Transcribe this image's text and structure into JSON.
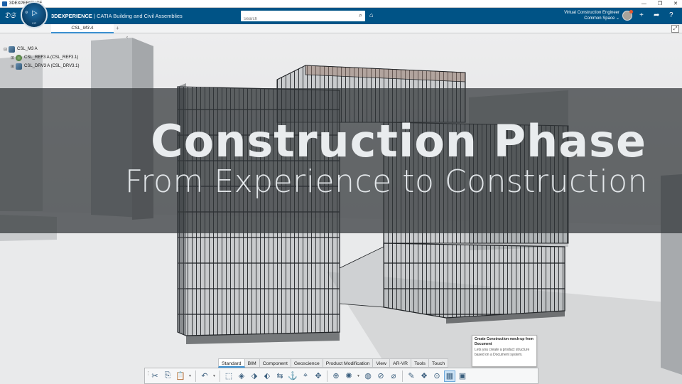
{
  "os_window": {
    "title": "3DEXPERIENCE",
    "minimize": "—",
    "restore": "❐",
    "close": "✕"
  },
  "header": {
    "brand_logo": "ds-logo-icon",
    "compass": {
      "quick_start": "⚙",
      "play": "▷",
      "version": "V.R"
    },
    "product": "3DEXPERIENCE",
    "separator": " | ",
    "app_name": "CATIA Building and Civil Assemblies",
    "search": {
      "placeholder": "Search",
      "value": ""
    },
    "user": {
      "name": "Virtual Construction Engineer",
      "space": "Common Space"
    },
    "icons": {
      "add": "+",
      "share": "➦",
      "help": "?"
    }
  },
  "tabs": [
    {
      "label": "CSL_M3 A",
      "active": true
    }
  ],
  "tab_add": "+",
  "tree": {
    "root": {
      "expander": "⊟",
      "label": "CSL_M3 A"
    },
    "children": [
      {
        "expander": "⊞",
        "label": "CSL_REF3 A (CSL_REF3.1)"
      },
      {
        "expander": "⊞",
        "label": "CSL_DRV3 A (CSL_DRV3.1)"
      }
    ]
  },
  "banner": {
    "title": "Construction Phase",
    "subtitle": "From Experience to Construction"
  },
  "tooltip": {
    "title": "Create Construction mock-up from Document",
    "description": "Lets you create a product structure based on a Document system."
  },
  "action_bar": {
    "sections": [
      {
        "label": "Standard",
        "active": true
      },
      {
        "label": "BIM",
        "active": false
      },
      {
        "label": "Component",
        "active": false
      },
      {
        "label": "Geoscience",
        "active": false
      },
      {
        "label": "Product Modification",
        "active": false
      },
      {
        "label": "View",
        "active": false
      },
      {
        "label": "AR-VR",
        "active": false
      },
      {
        "label": "Tools",
        "active": false
      },
      {
        "label": "Touch",
        "active": false
      }
    ],
    "tools": [
      {
        "name": "cut-icon",
        "glyph": "✂"
      },
      {
        "name": "copy-icon",
        "glyph": "⎘"
      },
      {
        "name": "paste-icon",
        "glyph": "📋"
      },
      {
        "name": "undo-icon",
        "glyph": "↶"
      },
      {
        "name": "insert-product-icon",
        "glyph": "⬚"
      },
      {
        "name": "insert-part-icon",
        "glyph": "◈"
      },
      {
        "name": "insert-document-icon",
        "glyph": "⬗"
      },
      {
        "name": "replace-icon",
        "glyph": "⬖"
      },
      {
        "name": "reorder-icon",
        "glyph": "⇆"
      },
      {
        "name": "constraint-icon",
        "glyph": "⚓"
      },
      {
        "name": "fix-icon",
        "glyph": "⌖"
      },
      {
        "name": "move-icon",
        "glyph": "✥"
      },
      {
        "name": "snap-icon",
        "glyph": "⊕"
      },
      {
        "name": "explode-icon",
        "glyph": "✺"
      },
      {
        "name": "clash-icon",
        "glyph": "◍"
      },
      {
        "name": "sectioning-icon",
        "glyph": "⊘"
      },
      {
        "name": "measure-icon",
        "glyph": "⌀"
      },
      {
        "name": "annotate-icon",
        "glyph": "✎"
      },
      {
        "name": "scene-icon",
        "glyph": "❖"
      },
      {
        "name": "camera-icon",
        "glyph": "⊙"
      },
      {
        "name": "mockup-from-document-icon",
        "glyph": "▦"
      },
      {
        "name": "construction-mockup-icon",
        "glyph": "▣"
      }
    ]
  }
}
